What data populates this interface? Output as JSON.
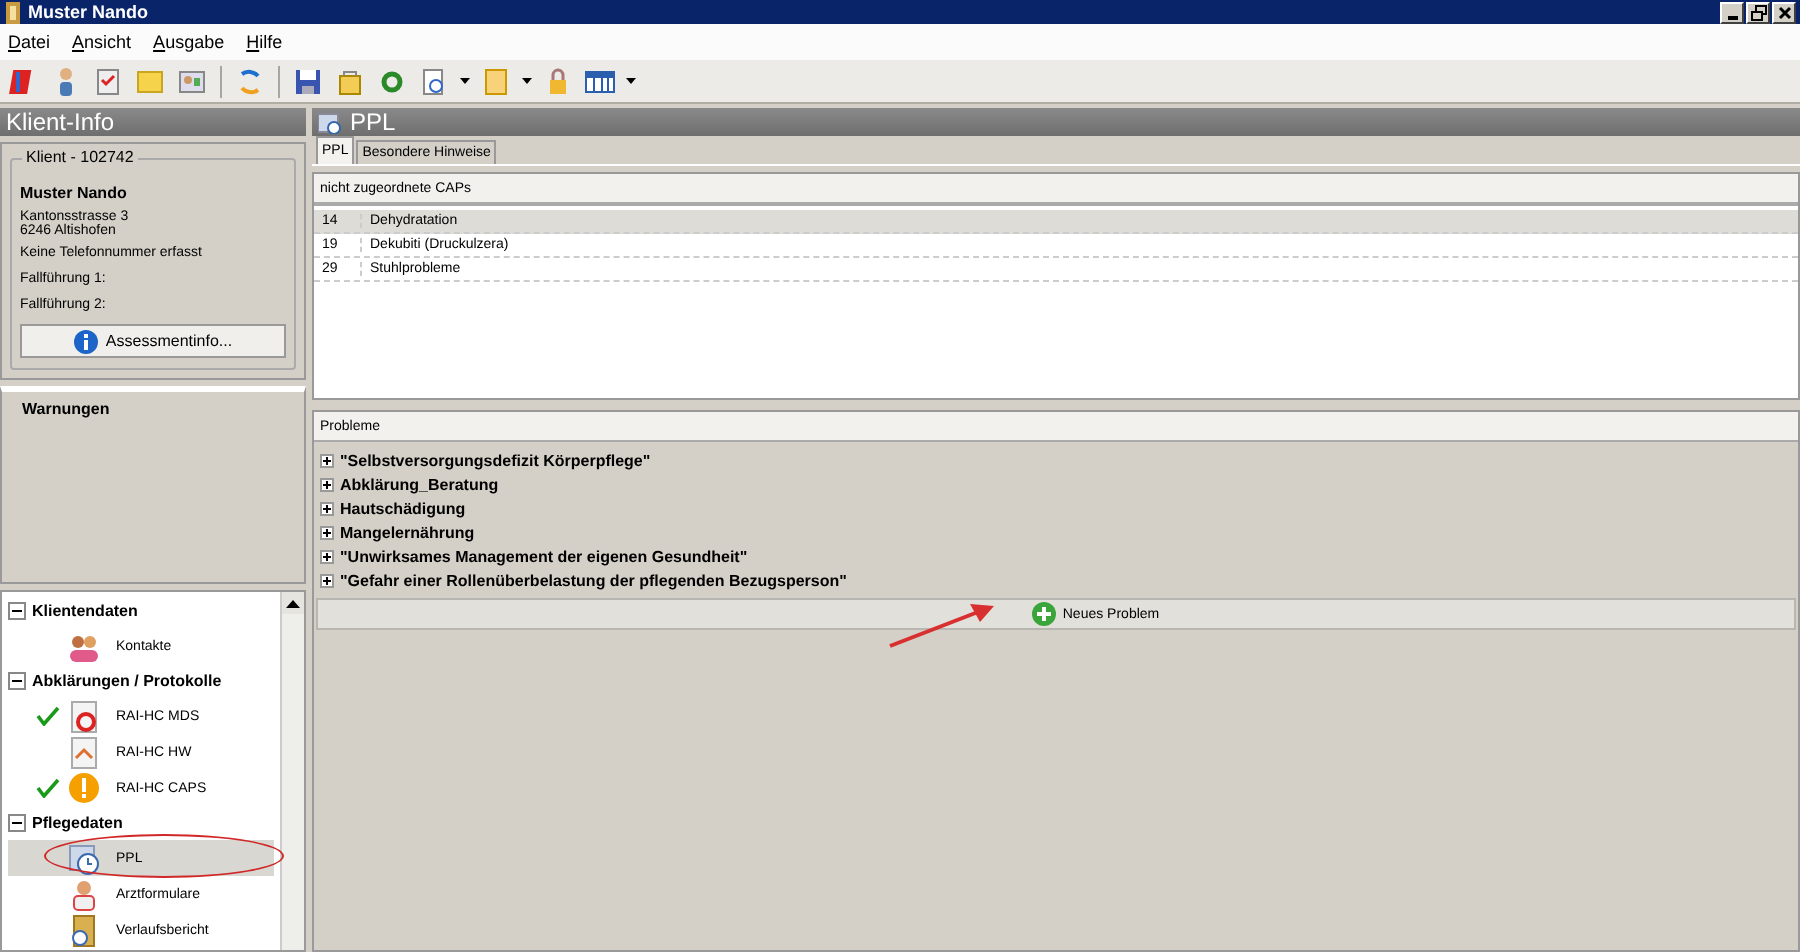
{
  "window": {
    "title": "Muster  Nando"
  },
  "menu": [
    "Datei",
    "Ansicht",
    "Ausgabe",
    "Hilfe"
  ],
  "client_info": {
    "title": "Klient-Info",
    "group_label": "Klient - 102742",
    "name": "Muster  Nando",
    "address": [
      "Kantonsstrasse 3",
      "6246 Altishofen"
    ],
    "phone": "Keine Telefonnummer erfasst",
    "case_1": "Fallführung 1:",
    "case_2": "Fallführung 2:",
    "button": "Assessmentinfo..."
  },
  "warnings": {
    "title": "Warnungen"
  },
  "navigation": [
    {
      "label": "Klientendaten",
      "expanded": true,
      "children": [
        {
          "label": "Kontakte",
          "kind": "contacts",
          "checked": false,
          "selected": false
        }
      ]
    },
    {
      "label": "Abklärungen / Protokolle",
      "expanded": true,
      "children": [
        {
          "label": "RAI-HC MDS",
          "kind": "form",
          "checked": true,
          "selected": false
        },
        {
          "label": "RAI-HC HW",
          "kind": "home",
          "checked": false,
          "selected": false
        },
        {
          "label": "RAI-HC CAPS",
          "kind": "warning",
          "checked": true,
          "selected": false
        }
      ]
    },
    {
      "label": "Pflegedaten",
      "expanded": true,
      "children": [
        {
          "label": "PPL",
          "kind": "clock",
          "checked": false,
          "selected": true
        },
        {
          "label": "Arztformulare",
          "kind": "doctor",
          "checked": false,
          "selected": false
        },
        {
          "label": "Verlaufsbericht",
          "kind": "folder",
          "checked": false,
          "selected": false
        }
      ]
    }
  ],
  "ppl": {
    "title": "PPL",
    "tabs": [
      {
        "label": "PPL",
        "selected": true
      },
      {
        "label": "Besondere Hinweise",
        "selected": false
      }
    ],
    "caps": {
      "header": "nicht zugeordnete CAPs",
      "rows": [
        {
          "number": "14",
          "name": "Dehydratation",
          "selected": true
        },
        {
          "number": "19",
          "name": "Dekubiti (Druckulzera)",
          "selected": false
        },
        {
          "number": "29",
          "name": "Stuhlprobleme",
          "selected": false
        }
      ]
    },
    "problems": {
      "header": "Probleme",
      "items": [
        {
          "label": "\"Selbstversorgungsdefizit Körperpflege\"",
          "expanded": false
        },
        {
          "label": "Abklärung_Beratung",
          "expanded": false
        },
        {
          "label": "Hautschädigung",
          "expanded": false
        },
        {
          "label": "Mangelernährung",
          "expanded": false
        },
        {
          "label": "\"Unwirksames Management der eigenen Gesundheit\"",
          "expanded": false
        },
        {
          "label": "\"Gefahr einer Rollenüberbelastung der pflegenden Bezugsperson\"",
          "expanded": false
        }
      ],
      "new_button": "Neues Problem"
    }
  }
}
